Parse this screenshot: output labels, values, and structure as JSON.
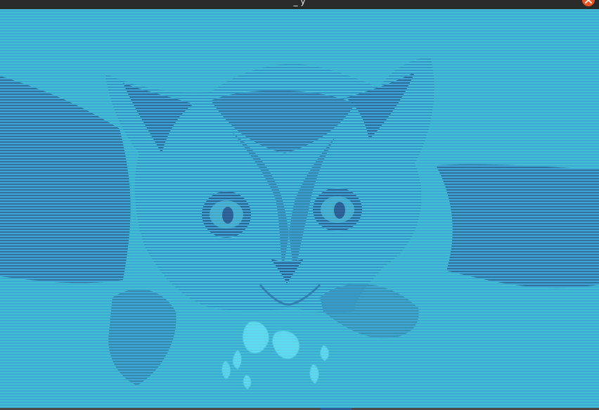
{
  "window": {
    "title": "_ y",
    "close_icon": "close-icon"
  },
  "image": {
    "description_colors": {
      "light": "#46cfe2",
      "mid": "#3b91c3",
      "dark": "#2f5f96",
      "highlight": "#6ff1ff"
    }
  }
}
